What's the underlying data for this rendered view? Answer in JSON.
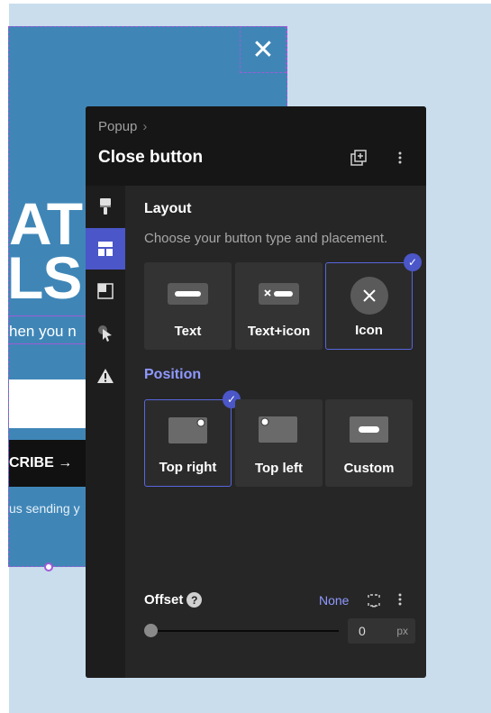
{
  "popup": {
    "close_glyph": "✕",
    "headline_line1": "ATI",
    "headline_line2": "LS",
    "subtitle": "hen you n",
    "subscribe_label": "CRIBE →",
    "fine_print": "us sending y"
  },
  "panel": {
    "breadcrumb": "Popup",
    "breadcrumb_sep": "›",
    "title": "Close button",
    "header_icons": [
      "layers-add-icon",
      "more-vertical-icon"
    ]
  },
  "rail": [
    "paintbrush-icon",
    "layout-icon",
    "layers-icon",
    "cursor-click-icon",
    "warning-icon"
  ],
  "layout": {
    "title": "Layout",
    "description": "Choose your button type and placement.",
    "types": [
      {
        "label": "Text",
        "selected": false
      },
      {
        "label": "Text+icon",
        "selected": false
      },
      {
        "label": "Icon",
        "selected": true
      }
    ]
  },
  "position": {
    "title": "Position",
    "options": [
      {
        "label": "Top right",
        "selected": true
      },
      {
        "label": "Top left",
        "selected": false
      },
      {
        "label": "Custom",
        "selected": false
      }
    ]
  },
  "offset": {
    "label": "Offset",
    "help": "?",
    "preset": "None",
    "value": "0",
    "unit": "px",
    "slider_value": 0
  },
  "colors": {
    "accent": "#4b56c8",
    "link": "#8f99ff",
    "popup_bg": "#3f86b7",
    "selection_outline": "#a05bd6"
  }
}
